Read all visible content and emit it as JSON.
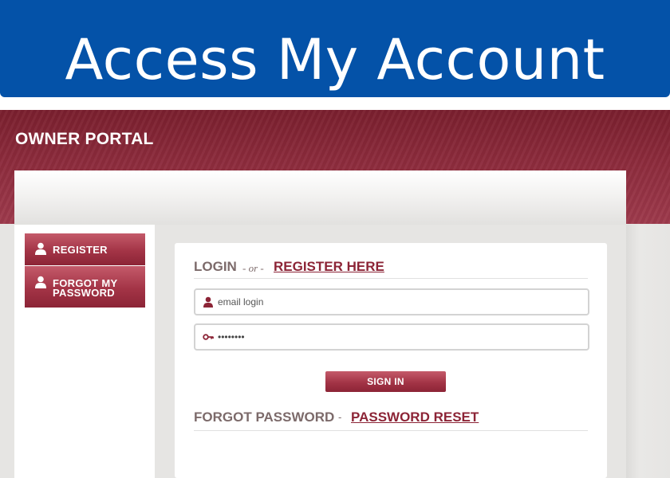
{
  "banner": {
    "title": "Access My Account"
  },
  "portal": {
    "title": "OWNER PORTAL",
    "sidebar": {
      "items": [
        {
          "label": "REGISTER",
          "icon": "user-icon"
        },
        {
          "label": "FORGOT MY PASSWORD",
          "icon": "user-icon"
        }
      ]
    },
    "login": {
      "title": "LOGIN",
      "separator": "- or -",
      "register_link": "REGISTER HERE",
      "email_placeholder": "email login",
      "password_value": "........",
      "sign_in_label": "SIGN IN"
    },
    "forgot": {
      "title": "FORGOT PASSWORD",
      "separator": "-",
      "reset_link": "PASSWORD RESET"
    }
  },
  "colors": {
    "banner_blue": "#0452a8",
    "portal_maroon": "#8c2436",
    "label_gray": "#7c6a6a"
  }
}
